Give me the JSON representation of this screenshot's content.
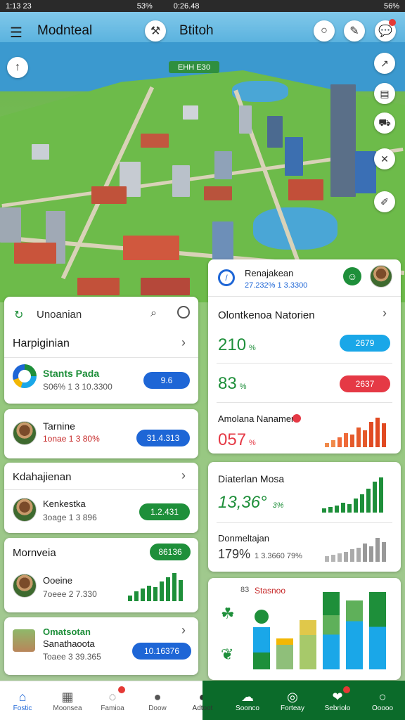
{
  "status": {
    "left": "1:13 23",
    "right_left": "53%",
    "center": "0:26.48",
    "right": "56%"
  },
  "header": {
    "title_left": "Modnteal",
    "title_right": "Btitoh"
  },
  "map": {
    "label": "ЕНН ЕЗ0"
  },
  "left_card1": {
    "header": "Unoanian",
    "title": "Harpiginian",
    "item_title": "Stants Pada",
    "item_sub": "S06% 1 3 10.3300",
    "pill": "9.6"
  },
  "left_card2": {
    "name": "Tarnine",
    "sub": "1onae 1 3 80%",
    "pill": "31.4.313"
  },
  "left_card3": {
    "title": "Kdahajienan",
    "name": "Kenkestka",
    "sub": "3oage 1 3 896",
    "pill": "1.2.431"
  },
  "left_card4": {
    "title": "Mornveia",
    "pill": "86136",
    "name": "Ooeine",
    "sub": "7oeee 2 7.330"
  },
  "left_card5": {
    "name": "Omatsotan",
    "name2": "Sanathaoota",
    "sub": "Toaee 3 39.365",
    "pill": "10.16376"
  },
  "right_card1": {
    "title": "Renajakean",
    "sub": "27.232% 1 3.3300",
    "list_title": "Olontkenoa Natorien",
    "row1_value": "210",
    "row1_unit": "%",
    "row1_pill": "2679",
    "row2_value": "83",
    "row2_unit": "%",
    "row2_pill": "2637"
  },
  "right_card2": {
    "title": "Amolana Nanamer",
    "value": "057",
    "unit": "%"
  },
  "right_card3": {
    "title": "Diaterlan Mosa",
    "value": "13,36°",
    "unit": "3%",
    "title2": "Donmeltajan",
    "value2": "179%",
    "sub2": "1 3.3660 79%"
  },
  "right_card4": {
    "num": "83",
    "title": "Stasnoo"
  },
  "nav": [
    {
      "label": "Fostic",
      "icon": "home-icon"
    },
    {
      "label": "Moonsea",
      "icon": "calendar-icon"
    },
    {
      "label": "Famioa",
      "icon": "chat-icon"
    },
    {
      "label": "Doow",
      "icon": "person-icon"
    },
    {
      "label": "Adtoot",
      "icon": "map-icon"
    },
    {
      "label": "Soonco",
      "icon": "cloud-icon"
    },
    {
      "label": "Forteay",
      "icon": "globe-icon"
    },
    {
      "label": "Sebriolo",
      "icon": "heart-icon"
    },
    {
      "label": "Ooooo",
      "icon": "circle-icon"
    }
  ],
  "colors": {
    "accent_blue": "#1e66d6",
    "accent_green": "#1e8f3a",
    "accent_red": "#e53945",
    "nav_green": "#0b6b2a"
  }
}
